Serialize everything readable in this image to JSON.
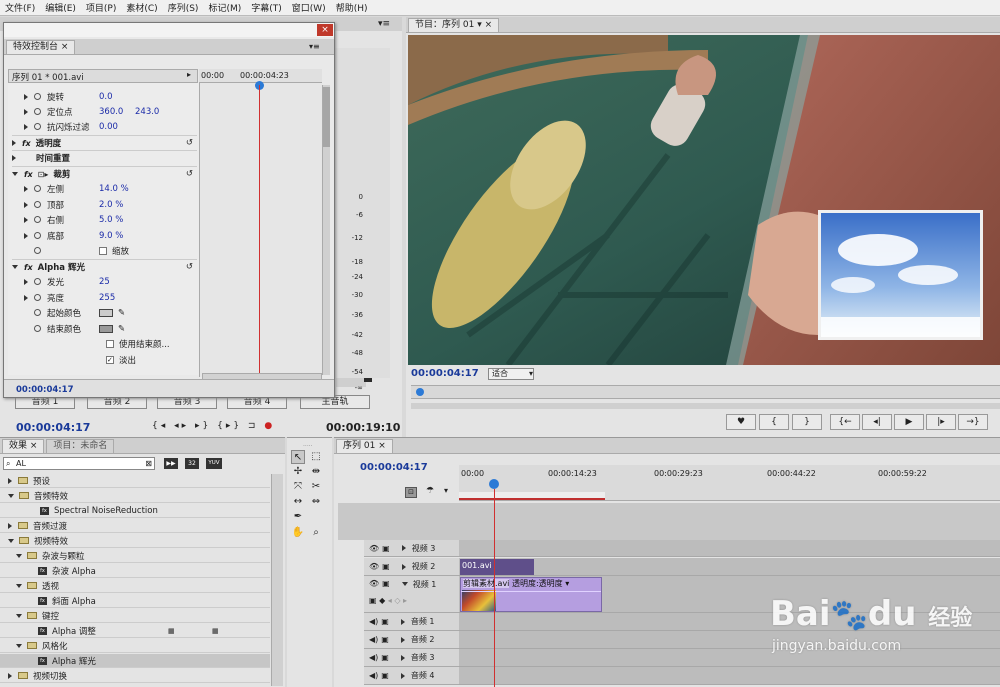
{
  "menu": [
    "文件(F)",
    "编辑(E)",
    "项目(P)",
    "素材(C)",
    "序列(S)",
    "标记(M)",
    "字幕(T)",
    "窗口(W)",
    "帮助(H)"
  ],
  "effect_controls": {
    "tab": "特效控制台",
    "close": "×",
    "sequence_label": "序列 01 * 001.avi",
    "ruler_start": "00:00",
    "ruler_mid": "00:00:04:23",
    "timecode": "00:00:04:17",
    "rows": [
      {
        "name": "旋转",
        "value": "0.0"
      },
      {
        "name": "定位点",
        "value": "360.0",
        "value2": "243.0"
      },
      {
        "name": "抗闪烁过滤",
        "value": "0.00"
      },
      {
        "name": "透明度"
      },
      {
        "name": "时间重置"
      },
      {
        "name": "裁剪"
      },
      {
        "name": "左侧",
        "value": "14.0 %"
      },
      {
        "name": "顶部",
        "value": "2.0 %"
      },
      {
        "name": "右侧",
        "value": "5.0 %"
      },
      {
        "name": "底部",
        "value": "9.0 %"
      },
      {
        "name": "缩放"
      },
      {
        "name": "Alpha 辉光"
      },
      {
        "name": "发光",
        "value": "25"
      },
      {
        "name": "亮度",
        "value": "255"
      },
      {
        "name": "起始颜色"
      },
      {
        "name": "结束颜色"
      },
      {
        "name": "使用结束颜..."
      },
      {
        "name": "淡出"
      }
    ]
  },
  "audio_mixer": {
    "db_labels": [
      "0",
      "-6",
      "-12",
      "-18",
      "-24",
      "-30",
      "-36",
      "-42",
      "-48",
      "-54",
      "-∞"
    ],
    "buttons": [
      "音频 1",
      "音频 2",
      "音频 3",
      "音频 4",
      "主音轨"
    ],
    "timecode_left": "00:00:04:17",
    "timecode_right": "00:00:19:10"
  },
  "program": {
    "tab": "节目：序列 01",
    "timecode": "00:00:04:17",
    "fit": "适合"
  },
  "effects": {
    "tab": "效果",
    "tab2": "项目：未命名",
    "search": "AL",
    "badges": [
      "32",
      "YUV"
    ],
    "tree": [
      {
        "label": "预设",
        "level": 0,
        "type": "folder"
      },
      {
        "label": "音频特效",
        "level": 0,
        "type": "folder",
        "open": true
      },
      {
        "label": "Spectral NoiseReduction",
        "level": 1,
        "type": "fx"
      },
      {
        "label": "音频过渡",
        "level": 0,
        "type": "folder"
      },
      {
        "label": "视频特效",
        "level": 0,
        "type": "folder",
        "open": true
      },
      {
        "label": "杂波与颗粒",
        "level": 1,
        "type": "folder",
        "open": true
      },
      {
        "label": "杂波 Alpha",
        "level": 2,
        "type": "fx"
      },
      {
        "label": "透视",
        "level": 1,
        "type": "folder",
        "open": true
      },
      {
        "label": "斜面 Alpha",
        "level": 2,
        "type": "fx"
      },
      {
        "label": "键控",
        "level": 1,
        "type": "folder",
        "open": true
      },
      {
        "label": "Alpha 调整",
        "level": 2,
        "type": "fx"
      },
      {
        "label": "风格化",
        "level": 1,
        "type": "folder",
        "open": true
      },
      {
        "label": "Alpha 辉光",
        "level": 2,
        "type": "fx",
        "selected": true
      },
      {
        "label": "视频切换",
        "level": 0,
        "type": "folder"
      }
    ]
  },
  "timeline": {
    "tab": "序列 01",
    "timecode": "00:00:04:17",
    "ruler": [
      "00:00",
      "00:00:14:23",
      "00:00:29:23",
      "00:00:44:22",
      "00:00:59:22"
    ],
    "tracks": [
      "视频 3",
      "视频 2",
      "视频 1",
      "音频 1",
      "音频 2",
      "音频 3",
      "音频 4"
    ],
    "clip_v2": "001.avi",
    "clip_v1": "剪辑素材.avi",
    "clip_v1_effect": "透明度:透明度"
  },
  "watermark": {
    "brand": "Bai",
    "brand2": "du",
    "cn": "经验",
    "url": "jingyan.baidu.com"
  }
}
